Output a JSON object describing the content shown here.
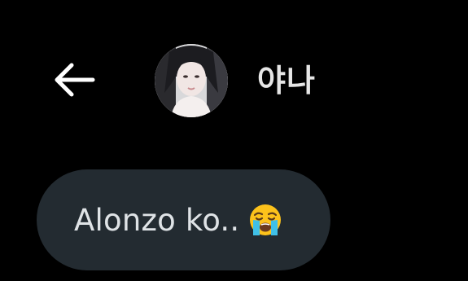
{
  "header": {
    "back_icon": "arrow-left-icon",
    "avatar_icon": "contact-photo",
    "contact_name": "야나"
  },
  "messages": [
    {
      "direction": "incoming",
      "text": "Alonzo ko..",
      "emoji_icon": "loudly-crying-face-emoji"
    }
  ],
  "colors": {
    "background": "#000000",
    "bubble": "#232b31",
    "text": "#dfe3e6",
    "name": "#e6e6e6"
  }
}
